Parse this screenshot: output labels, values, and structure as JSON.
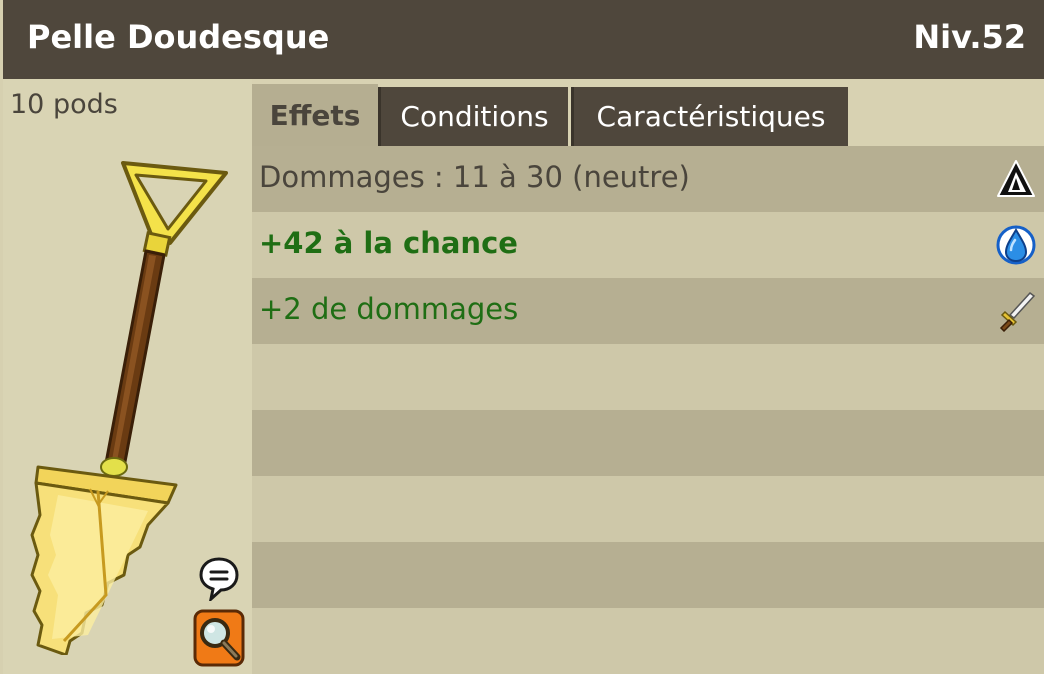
{
  "header": {
    "item_name": "Pelle Doudesque",
    "level": "Niv.52"
  },
  "left": {
    "weight": "10 pods",
    "item_icon": "golden-shovel-icon",
    "chat_icon": "speech-bubble-icon",
    "zoom_icon": "magnifier-icon"
  },
  "tabs": [
    {
      "label": "Effets",
      "active": true
    },
    {
      "label": "Conditions",
      "active": false
    },
    {
      "label": "Caractéristiques",
      "active": false
    }
  ],
  "effects": [
    {
      "text": "Dommages : 11 à 30 (neutre)",
      "color": "#4a453c",
      "bold": false,
      "icon": "neutral-element-icon"
    },
    {
      "text": "+42 à la chance",
      "color": "#1f6e14",
      "bold": true,
      "icon": "water-drop-icon"
    },
    {
      "text": "+2 de dommages",
      "color": "#1f6e14",
      "bold": false,
      "icon": "sword-icon"
    }
  ],
  "colors": {
    "titlebar": "#4f473c",
    "panel": "#d8d2b2",
    "row_dark": "#b6af92",
    "row_light": "#cec8a9",
    "bonus_green": "#1f6e14"
  }
}
